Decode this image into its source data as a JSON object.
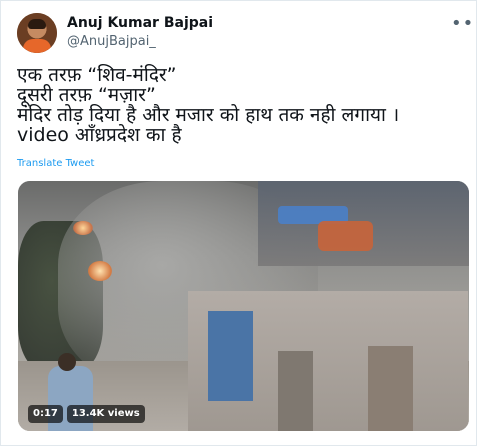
{
  "tweet": {
    "author_name": "Anuj Kumar Bajpai",
    "author_handle": "@AnujBajpai_",
    "lines": [
      "एक तरफ़ “शिव-मंदिर”",
      "दूसरी तरफ़ “मज़ार”",
      "मंदिर तोड़ दिया है और मजार को हाथ तक नही लगाया ।",
      "video आँध्रप्रदेश का है"
    ],
    "translate_label": "Translate Tweet"
  },
  "video": {
    "duration": "0:17",
    "views": "13.4K views"
  },
  "icons": {
    "more": "more-horizontal-icon"
  },
  "colors": {
    "link": "#1d9bf0",
    "secondary_text": "#536471"
  }
}
